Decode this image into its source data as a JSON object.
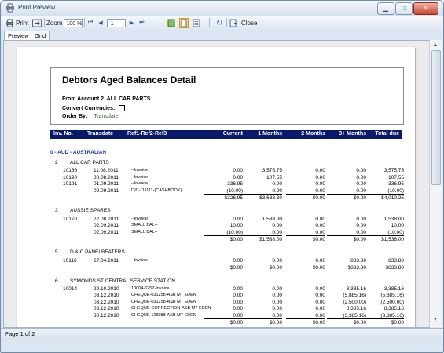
{
  "window": {
    "title": "Print Preview"
  },
  "toolbar": {
    "print": "Print",
    "zoom_label": "Zoom",
    "zoom_value": "100 %",
    "page_value": "1",
    "close": "Close"
  },
  "tabs": [
    {
      "label": "Preview"
    },
    {
      "label": "Grid"
    }
  ],
  "status": {
    "text": "Page 1 of 2"
  },
  "report": {
    "title": "Debtors Aged Balances Detail",
    "from_account": "From Account 2. ALL CAR PARTS",
    "convert_label": "Convert Currencies:",
    "order_label": "Order By:",
    "order_value": "Transdate",
    "columns": [
      "Inv. No.",
      "Transdate",
      "Ref1-Ref2-Ref3",
      "Current",
      "1 Months",
      "2 Months",
      "3+ Months",
      "Total due"
    ],
    "currency_group": "0 - AUD - AUSTRALIAN",
    "groups": [
      {
        "id": "2",
        "name": "ALL CAR PARTS",
        "rows": [
          {
            "inv": "10166",
            "date": "11.08.2011",
            "ref": "--Invoice",
            "cur": "0.00",
            "m1": "3,575.75",
            "m2": "0.00",
            "m3": "0.00",
            "tot": "3,575.75"
          },
          {
            "inv": "10190",
            "date": "30.08.2011",
            "ref": "--Invoice",
            "cur": "0.00",
            "m1": "107.55",
            "m2": "0.00",
            "m3": "0.00",
            "tot": "107.55"
          },
          {
            "inv": "10191",
            "date": "01.09.2011",
            "ref": "--Invoice",
            "cur": "336.95",
            "m1": "0.00",
            "m2": "0.00",
            "m3": "0.00",
            "tot": "336.95"
          },
          {
            "inv": "",
            "date": "02.09.2011",
            "ref": "D/C-111111-(CASHBOOK)",
            "cur": "(10.00)",
            "m1": "0.00",
            "m2": "0.00",
            "m3": "0.00",
            "tot": "(10.00)"
          }
        ],
        "totals": {
          "cur": "$326.95",
          "m1": "$3,683.30",
          "m2": "$0.00",
          "m3": "$0.00",
          "tot": "$4,010.25"
        }
      },
      {
        "id": "3",
        "name": "AUSSIE SPARES",
        "rows": [
          {
            "inv": "10170",
            "date": "22.08.2011",
            "ref": "--Invoice",
            "cur": "0.00",
            "m1": "1,538.00",
            "m2": "0.00",
            "m3": "0.00",
            "tot": "1,538.00"
          },
          {
            "inv": "",
            "date": "02.09.2011",
            "ref": "SMALL BAL--",
            "cur": "10.00",
            "m1": "0.00",
            "m2": "0.00",
            "m3": "0.00",
            "tot": "10.00"
          },
          {
            "inv": "",
            "date": "02.09.2011",
            "ref": "SMALL BAL--",
            "cur": "(10.00)",
            "m1": "0.00",
            "m2": "0.00",
            "m3": "0.00",
            "tot": "(10.00)"
          }
        ],
        "totals": {
          "cur": "$0.00",
          "m1": "$1,538.00",
          "m2": "$0.00",
          "m3": "$0.00",
          "tot": "$1,538.00"
        }
      },
      {
        "id": "5",
        "name": "D & C PANELBEATERS",
        "rows": [
          {
            "inv": "10116",
            "date": "27.04.2011",
            "ref": "--Invoice",
            "cur": "0.00",
            "m1": "0.00",
            "m2": "0.00",
            "m3": "833.80",
            "tot": "833.80"
          }
        ],
        "totals": {
          "cur": "$0.00",
          "m1": "$0.00",
          "m2": "$0.00",
          "m3": "$833.80",
          "tot": "$833.80"
        }
      },
      {
        "id": "6",
        "name": "SYMONDS ST CENTRAL SERVICE STATION",
        "rows": [
          {
            "inv": "10014",
            "date": "29.10.2010",
            "ref": "10004-6257-Invoice",
            "cur": "0.00",
            "m1": "0.00",
            "m2": "0.00",
            "m3": "3,385.16",
            "tot": "3,385.16"
          },
          {
            "inv": "",
            "date": "03.12.2010",
            "ref": "CHEQUE-031258-ASB MT EDEN",
            "cur": "0.00",
            "m1": "0.00",
            "m2": "0.00",
            "m3": "(5,885.16)",
            "tot": "(5,885.16)"
          },
          {
            "inv": "",
            "date": "03.12.2010",
            "ref": "CHEQUE-031258-ASB MT EDEN",
            "cur": "0.00",
            "m1": "0.00",
            "m2": "0.00",
            "m3": "(2,500.00)",
            "tot": "(2,500.00)"
          },
          {
            "inv": "",
            "date": "03.12.2010",
            "ref": "CHEQUE-CORRECTION-ASB MT EDEN",
            "cur": "0.00",
            "m1": "0.00",
            "m2": "0.00",
            "m3": "8,385.16",
            "tot": "8,385.16"
          },
          {
            "inv": "",
            "date": "30.12.2010",
            "ref": "CHEQUE-123058-ASB MT EDEN",
            "cur": "0.00",
            "m1": "0.00",
            "m2": "0.00",
            "m3": "(3,385.16)",
            "tot": "(3,385.16)"
          }
        ],
        "totals": {
          "cur": "$0.00",
          "m1": "$0.00",
          "m2": "$0.00",
          "m3": "$0.00",
          "tot": "$0.00"
        }
      }
    ]
  }
}
